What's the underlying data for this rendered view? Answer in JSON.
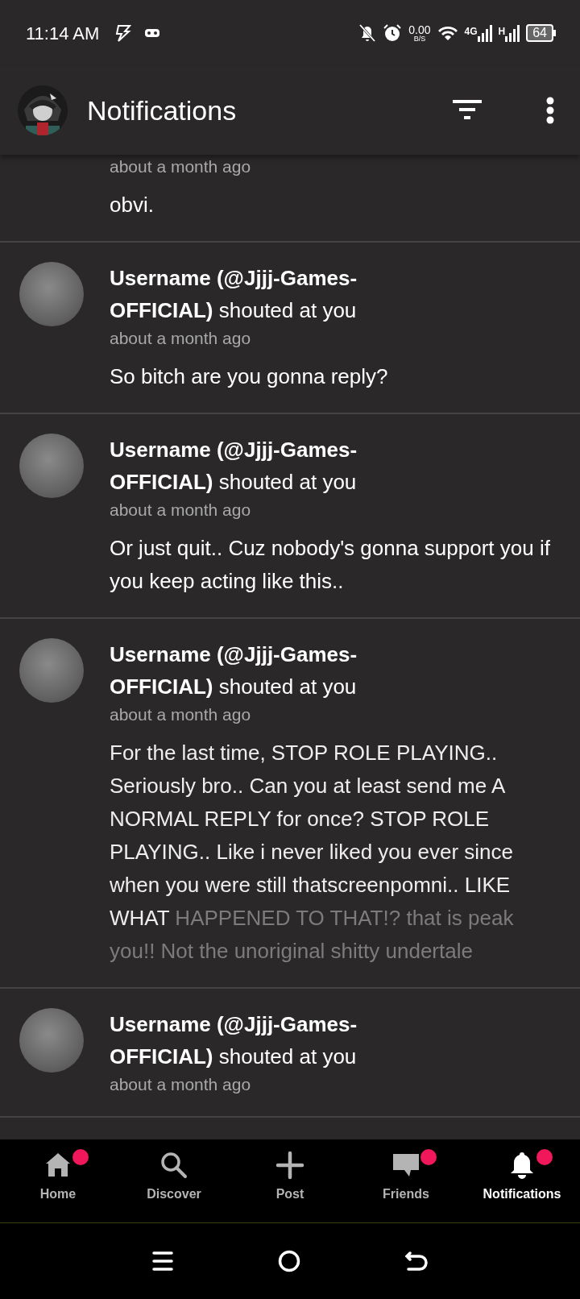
{
  "status_bar": {
    "time": "11:14 AM",
    "net_speed": "0.00",
    "net_unit": "B/S",
    "sim1": "4G",
    "sim2": "H",
    "battery": "64"
  },
  "header": {
    "title": "Notifications"
  },
  "notifications": [
    {
      "kind": "partial",
      "time": "about a month ago",
      "message": "obvi."
    },
    {
      "kind": "shout",
      "user": "Username (@Jjjj-Games-OFFICIAL)",
      "action": "shouted at you",
      "time": "about a month ago",
      "message": "So bitch are you gonna reply?",
      "faded": false
    },
    {
      "kind": "shout",
      "user": "Username (@Jjjj-Games-OFFICIAL)",
      "action": "shouted at you",
      "time": "about a month ago",
      "message": "Or just quit.. Cuz nobody's gonna support you if you keep acting like this..",
      "faded": false
    },
    {
      "kind": "shout",
      "user": "Username (@Jjjj-Games-OFFICIAL)",
      "action": "shouted at you",
      "time": "about a month ago",
      "message": "For the last time, STOP ROLE PLAYING.. Seriously bro.. Can you at least send me A NORMAL REPLY for once? STOP ROLE PLAYING.. Like i never liked you ever since when you were still thatscreenpomni.. LIKE WHAT",
      "faded_text": "HAPPENED TO THAT!? that is peak you!! Not the unoriginal shitty undertale",
      "faded": true
    },
    {
      "kind": "shout",
      "user": "Username (@Jjjj-Games-OFFICIAL)",
      "action": "shouted at you",
      "time": "about a month ago"
    }
  ],
  "bottom_nav": [
    {
      "kind": "home",
      "label": "Home",
      "selected": false,
      "dot": true
    },
    {
      "kind": "discover",
      "label": "Discover",
      "selected": false,
      "dot": false
    },
    {
      "kind": "post",
      "label": "Post",
      "selected": false,
      "dot": false
    },
    {
      "kind": "friends",
      "label": "Friends",
      "selected": false,
      "dot": true
    },
    {
      "kind": "notifications",
      "label": "Notifications",
      "selected": true,
      "dot": true
    }
  ]
}
